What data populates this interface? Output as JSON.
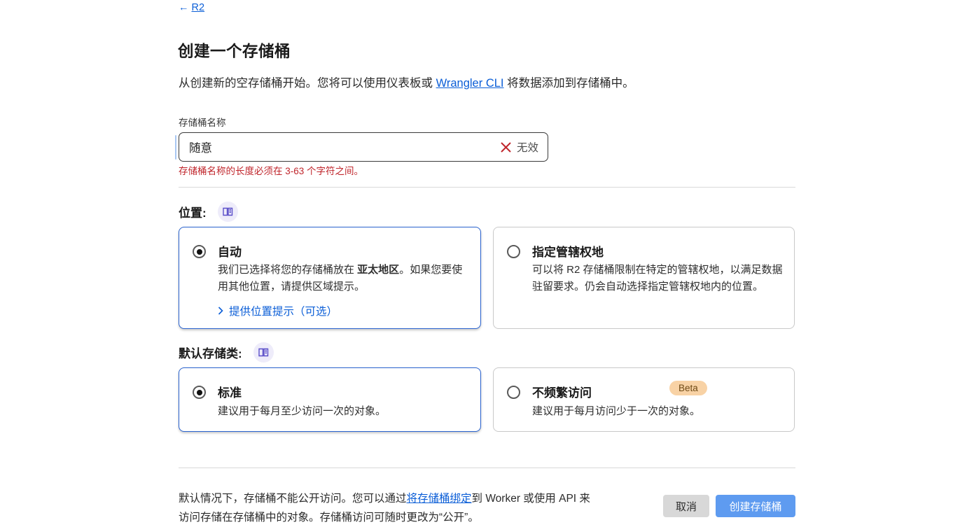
{
  "header": {
    "back_arrow": "←",
    "back_label": "R2",
    "title": "创建一个存储桶",
    "intro_before": "从创建新的空存储桶开始。您将可以使用仪表板或 ",
    "intro_link": "Wrangler CLI",
    "intro_after": " 将数据添加到存储桶中。"
  },
  "bucket_name": {
    "label": "存储桶名称",
    "value": "随意",
    "invalid_label": "无效",
    "error": "存储桶名称的长度必须在 3-63 个字符之间。"
  },
  "location": {
    "heading": "位置:",
    "auto": {
      "title": "自动",
      "desc_before": "我们已选择将您的存储桶放在 ",
      "desc_bold": "亚太地区",
      "desc_after": "。如果您要使用其他位置，请提供区域提示。",
      "hint_link": "提供位置提示（可选）"
    },
    "jurisdiction": {
      "title": "指定管辖权地",
      "desc": "可以将 R2 存储桶限制在特定的管辖权地，以满足数据驻留要求。仍会自动选择指定管辖权地内的位置。"
    }
  },
  "storage_class": {
    "heading": "默认存储类:",
    "standard": {
      "title": "标准",
      "desc": "建议用于每月至少访问一次的对象。"
    },
    "infrequent": {
      "title": "不频繁访问",
      "badge": "Beta",
      "desc": "建议用于每月访问少于一次的对象。"
    }
  },
  "footer": {
    "line_before_link": "默认情况下，存储桶不能公开访问。您可以通过",
    "link": "将存储桶绑定",
    "line_after_link": "到 Worker 或使用 API 来访问存储在存储桶中的对象。存储桶访问可随时更改为“公开”。",
    "cancel": "取消",
    "create": "创建存储桶"
  },
  "colors": {
    "link_blue": "#0b5ed7",
    "selected_card_border": "#2a63cf",
    "error_red": "#c0262c",
    "create_button_bg": "#5e9bf0",
    "cancel_button_bg": "#d8d8d8",
    "beta_badge_bg": "#f8d2a5",
    "beta_badge_text": "#6f4a16",
    "doc_icon_purple": "#5b4fc9"
  }
}
